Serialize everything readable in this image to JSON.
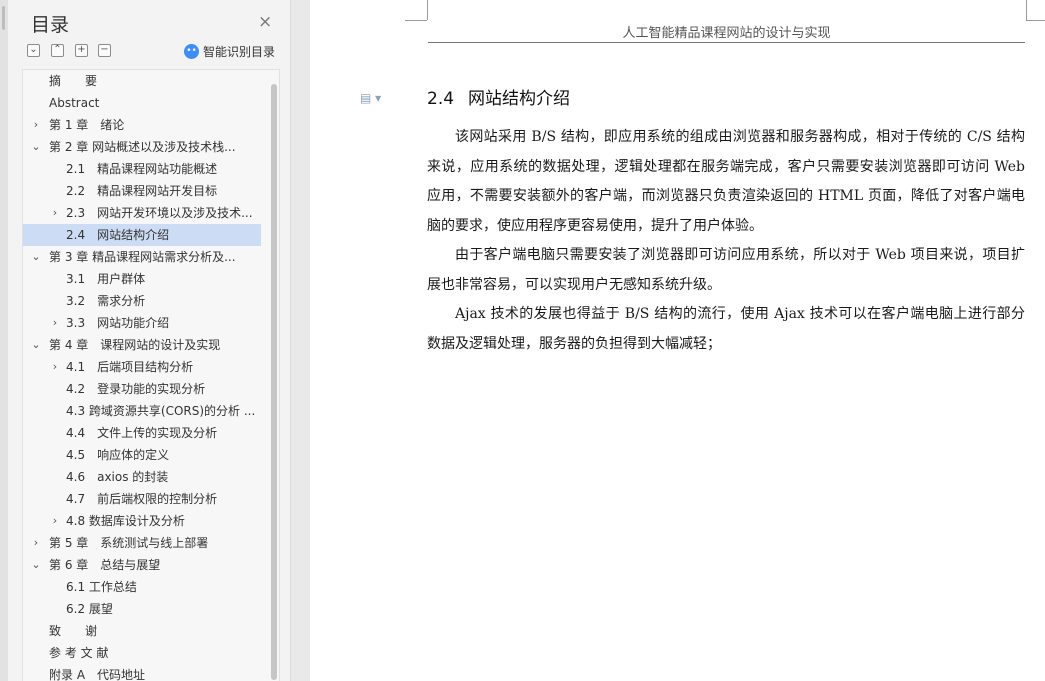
{
  "toc": {
    "title": "目录",
    "close_glyph": "×",
    "toolbar": {
      "expand_all": "⌄",
      "collapse_all": "⌃",
      "add": "+",
      "remove": "−"
    },
    "smart_toc_label": "智能识别目录",
    "items": [
      {
        "level": 1,
        "arrow": "",
        "text": "摘　　要"
      },
      {
        "level": 1,
        "arrow": "",
        "text": "Abstract"
      },
      {
        "level": 1,
        "arrow": "›",
        "text": "第 1 章　绪论"
      },
      {
        "level": 1,
        "arrow": "⌄",
        "text": "第 2 章 网站概述以及涉及技术栈..."
      },
      {
        "level": 2,
        "arrow": "",
        "text": "2.1　精品课程网站功能概述"
      },
      {
        "level": 2,
        "arrow": "",
        "text": "2.2　精品课程网站开发目标"
      },
      {
        "level": 2,
        "arrow": "›",
        "text": "2.3　网站开发环境以及涉及技术..."
      },
      {
        "level": 2,
        "arrow": "",
        "text": "2.4　网站结构介绍",
        "selected": true
      },
      {
        "level": 1,
        "arrow": "⌄",
        "text": "第 3 章 精品课程网站需求分析及..."
      },
      {
        "level": 2,
        "arrow": "",
        "text": "3.1　用户群体"
      },
      {
        "level": 2,
        "arrow": "",
        "text": "3.2　需求分析"
      },
      {
        "level": 2,
        "arrow": "›",
        "text": "3.3　网站功能介绍"
      },
      {
        "level": 1,
        "arrow": "⌄",
        "text": "第 4 章　课程网站的设计及实现"
      },
      {
        "level": 2,
        "arrow": "›",
        "text": "4.1　后端项目结构分析"
      },
      {
        "level": 2,
        "arrow": "",
        "text": "4.2　登录功能的实现分析"
      },
      {
        "level": 2,
        "arrow": "",
        "text": "4.3 跨域资源共享(CORS)的分析 ..."
      },
      {
        "level": 2,
        "arrow": "",
        "text": "4.4　文件上传的实现及分析"
      },
      {
        "level": 2,
        "arrow": "",
        "text": "4.5　响应体的定义"
      },
      {
        "level": 2,
        "arrow": "",
        "text": "4.6　axios 的封装"
      },
      {
        "level": 2,
        "arrow": "",
        "text": "4.7　前后端权限的控制分析"
      },
      {
        "level": 2,
        "arrow": "›",
        "text": "4.8 数据库设计及分析"
      },
      {
        "level": 1,
        "arrow": "›",
        "text": "第 5 章　系统测试与线上部署"
      },
      {
        "level": 1,
        "arrow": "⌄",
        "text": "第 6 章　总结与展望"
      },
      {
        "level": 2,
        "arrow": "",
        "text": "6.1 工作总结"
      },
      {
        "level": 2,
        "arrow": "",
        "text": "6.2 展望"
      },
      {
        "level": 1,
        "arrow": "",
        "text": "致　　谢"
      },
      {
        "level": 1,
        "arrow": "",
        "text": "参 考 文 献"
      },
      {
        "level": 1,
        "arrow": "",
        "text": "附录 A　代码地址"
      }
    ]
  },
  "document": {
    "header": "人工智能精品课程网站的设计与实现",
    "section_number": "2.4",
    "section_title": "网站结构介绍",
    "paragraphs": [
      "该网站采用 B/S 结构，即应用系统的组成由浏览器和服务器构成，相对于传统的 C/S 结构来说，应用系统的数据处理，逻辑处理都在服务端完成，客户只需要安装浏览器即可访问 Web 应用，不需要安装额外的客户端，而浏览器只负责渲染返回的 HTML 页面，降低了对客户端电脑的要求，使应用程序更容易使用，提升了用户体验。",
      "由于客户端电脑只需要安装了浏览器即可访问应用系统，所以对于 Web 项目来说，项目扩展也非常容易，可以实现用户无感知系统升级。",
      "Ajax 技术的发展也得益于 B/S 结构的流行，使用 Ajax 技术可以在客户端电脑上进行部分数据及逻辑处理，服务器的负担得到大幅减轻；"
    ]
  },
  "colors": {
    "selected_row": "#cddcf5",
    "panel_bg": "#f3f3f3",
    "page_bg": "#ffffff",
    "ai_badge": "#3e8ef7"
  }
}
